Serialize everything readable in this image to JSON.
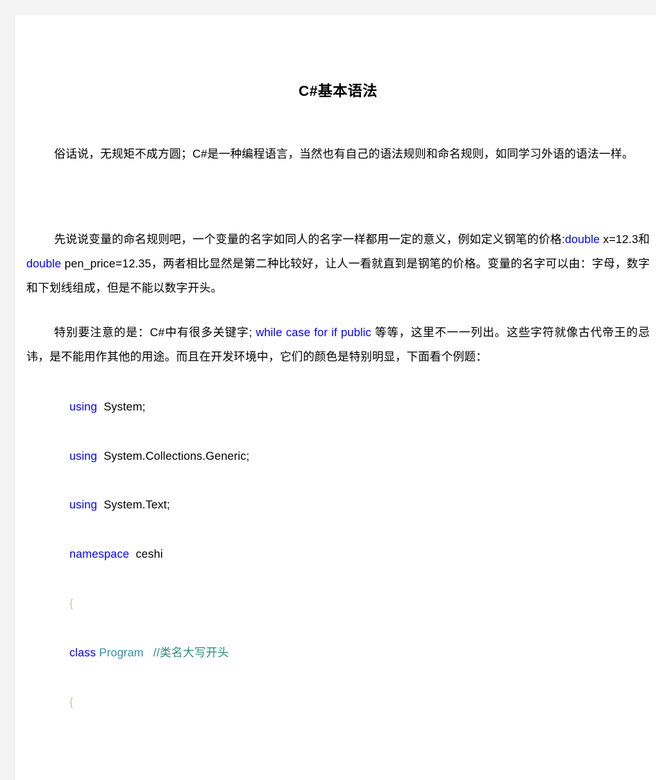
{
  "document": {
    "title": "C#基本语法",
    "background_color": "#f3f3f3",
    "page_color": "#ffffff",
    "keyword_color": "#0000ff",
    "type_color": "#2b91af",
    "comment_color": "#2e8b80",
    "brace_color": "#c9c4bd"
  },
  "paragraphs": {
    "p1": "俗话说，无规矩不成方圆；C#是一种编程语言，当然也有自己的语法规则和命名规则，如同学习外语的语法一样。",
    "p2": {
      "lead": "先说说变量的命名规则吧，一个变量的名字如同人的名字一样都用一定的意义，例如定义钢笔的价格:",
      "kw1": "double",
      "mid1": " x=12.3和 ",
      "kw2": "double",
      "mid2": "  pen_price=12.35，两者相比显然是第二种比较好，让人一看就直到是钢笔的价格。变量的名字可以由：字母，数字和下划线组成，但是不能以数字开头。"
    },
    "p3": {
      "lead": "特别要注意的是：C#中有很多关键字;",
      "keywords": " while case  for if public",
      "tail": " 等等，这里不一一列出。这些字符就像古代帝王的忌讳，是不能用作其他的用途。而且在开发环境中，它们的颜色是特别明显，下面看个例题："
    }
  },
  "code_block": {
    "lines": [
      {
        "id": "using-system",
        "kw": "using",
        "rest": "  System;",
        "type": "",
        "comment": ""
      },
      {
        "id": "using-collections",
        "kw": "using",
        "rest": "  System.Collections.Generic;",
        "type": "",
        "comment": ""
      },
      {
        "id": "using-text",
        "kw": "using",
        "rest": "  System.Text;",
        "type": "",
        "comment": ""
      },
      {
        "id": "namespace-ceshi",
        "kw": "namespace",
        "rest": "  ceshi",
        "type": "",
        "comment": ""
      },
      {
        "id": "open-brace-1",
        "kw": "",
        "rest": "",
        "type": "",
        "comment": "",
        "brace": "{"
      },
      {
        "id": "class-program",
        "kw": "class",
        "rest": " ",
        "type": "Program",
        "comment": "   //类名大写开头"
      },
      {
        "id": "open-brace-2",
        "kw": "",
        "rest": "",
        "type": "",
        "comment": "",
        "brace": "{"
      }
    ]
  }
}
